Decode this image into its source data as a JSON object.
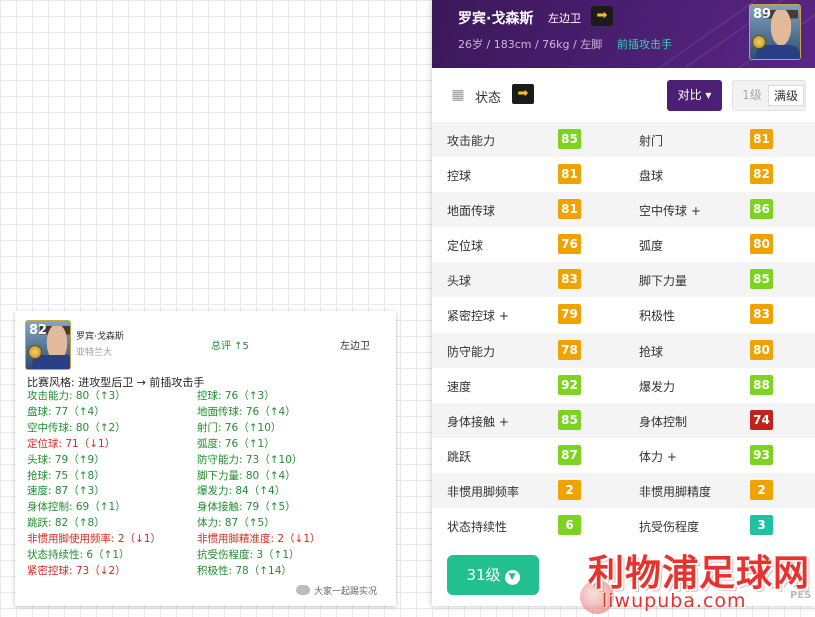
{
  "colors": {
    "green": "#7ed321",
    "orange": "#f0a200",
    "red": "#c0221e",
    "teal": "#1fc3a1",
    "purple": "#4b1f73"
  },
  "player": {
    "name": "罗宾·戈森斯",
    "position": "左边卫",
    "info": "26岁 / 183cm / 76kg / 左脚",
    "style": "前插攻击手",
    "rating": "89"
  },
  "status": {
    "label": "状态",
    "compare": "对比 ▾",
    "level_options": [
      "1级",
      "满级"
    ],
    "level_selected": "满级"
  },
  "stats": [
    {
      "left": {
        "name": "攻击能力",
        "value": "85",
        "color": "green"
      },
      "right": {
        "name": "射门",
        "value": "81",
        "color": "orange"
      }
    },
    {
      "left": {
        "name": "控球",
        "value": "81",
        "color": "orange"
      },
      "right": {
        "name": "盘球",
        "value": "82",
        "color": "orange"
      }
    },
    {
      "left": {
        "name": "地面传球",
        "value": "81",
        "color": "orange"
      },
      "right": {
        "name": "空中传球 +",
        "value": "86",
        "color": "green"
      }
    },
    {
      "left": {
        "name": "定位球",
        "value": "76",
        "color": "orange"
      },
      "right": {
        "name": "弧度",
        "value": "80",
        "color": "orange"
      }
    },
    {
      "left": {
        "name": "头球",
        "value": "83",
        "color": "orange"
      },
      "right": {
        "name": "脚下力量",
        "value": "85",
        "color": "green"
      }
    },
    {
      "left": {
        "name": "紧密控球 +",
        "value": "79",
        "color": "orange"
      },
      "right": {
        "name": "积极性",
        "value": "83",
        "color": "orange"
      }
    },
    {
      "left": {
        "name": "防守能力",
        "value": "78",
        "color": "orange"
      },
      "right": {
        "name": "抢球",
        "value": "80",
        "color": "orange"
      }
    },
    {
      "left": {
        "name": "速度",
        "value": "92",
        "color": "green"
      },
      "right": {
        "name": "爆发力",
        "value": "88",
        "color": "green"
      }
    },
    {
      "left": {
        "name": "身体接触 +",
        "value": "85",
        "color": "green"
      },
      "right": {
        "name": "身体控制",
        "value": "74",
        "color": "red"
      }
    },
    {
      "left": {
        "name": "跳跃",
        "value": "87",
        "color": "green"
      },
      "right": {
        "name": "体力 +",
        "value": "93",
        "color": "green"
      }
    },
    {
      "left": {
        "name": "非惯用脚频率",
        "value": "2",
        "color": "orange"
      },
      "right": {
        "name": "非惯用脚精度",
        "value": "2",
        "color": "orange"
      }
    },
    {
      "left": {
        "name": "状态持续性",
        "value": "6",
        "color": "green"
      },
      "right": {
        "name": "抗受伤程度",
        "value": "3",
        "color": "teal"
      }
    }
  ],
  "level_button": {
    "label": "31级",
    "icon": "chevron-down-icon"
  },
  "left_card": {
    "rating": "82",
    "name": "罗宾·戈森斯",
    "club": "亚特兰大",
    "total": "总评 ↑5",
    "position": "左边卫",
    "style_change": "比赛风格: 进攻型后卫 → 前插攻击手",
    "left_lines": [
      {
        "text": "攻击能力: 80（↑3）",
        "tone": "g"
      },
      {
        "text": "盘球: 77（↑4）",
        "tone": "g"
      },
      {
        "text": "空中传球: 80（↑2）",
        "tone": "g"
      },
      {
        "text": "定位球: 71（↓1）",
        "tone": "r"
      },
      {
        "text": "头球: 79（↑9）",
        "tone": "g"
      },
      {
        "text": "抢球: 75（↑8）",
        "tone": "g"
      },
      {
        "text": "速度: 87（↑3）",
        "tone": "g"
      },
      {
        "text": "身体控制: 69（↑1）",
        "tone": "g"
      },
      {
        "text": "跳跃: 82（↑8）",
        "tone": "g"
      },
      {
        "text": "非惯用脚使用频率: 2（↓1）",
        "tone": "r"
      },
      {
        "text": "状态持续性: 6（↑1）",
        "tone": "g"
      },
      {
        "text": "紧密控球: 73（↓2）",
        "tone": "r"
      }
    ],
    "right_lines": [
      {
        "text": "控球: 76（↑3）",
        "tone": "g"
      },
      {
        "text": "地面传球: 76（↑4）",
        "tone": "g"
      },
      {
        "text": "射门: 76（↑10）",
        "tone": "g"
      },
      {
        "text": "弧度: 76（↑1）",
        "tone": "g"
      },
      {
        "text": "防守能力: 73（↑10）",
        "tone": "g"
      },
      {
        "text": "脚下力量: 80（↑4）",
        "tone": "g"
      },
      {
        "text": "爆发力: 84（↑4）",
        "tone": "g"
      },
      {
        "text": "身体接触: 79（↑5）",
        "tone": "g"
      },
      {
        "text": "体力: 87（↑5）",
        "tone": "g"
      },
      {
        "text": "非惯用脚精准度: 2（↓1）",
        "tone": "r"
      },
      {
        "text": "抗受伤程度: 3（↑1）",
        "tone": "g"
      },
      {
        "text": "积极性: 78（↑14）",
        "tone": "g"
      }
    ],
    "watermark": "大家一起踢实况"
  },
  "site_watermark": {
    "title": "利物浦足球网",
    "url": "liwupuba.com"
  },
  "corner_logo": "PES"
}
